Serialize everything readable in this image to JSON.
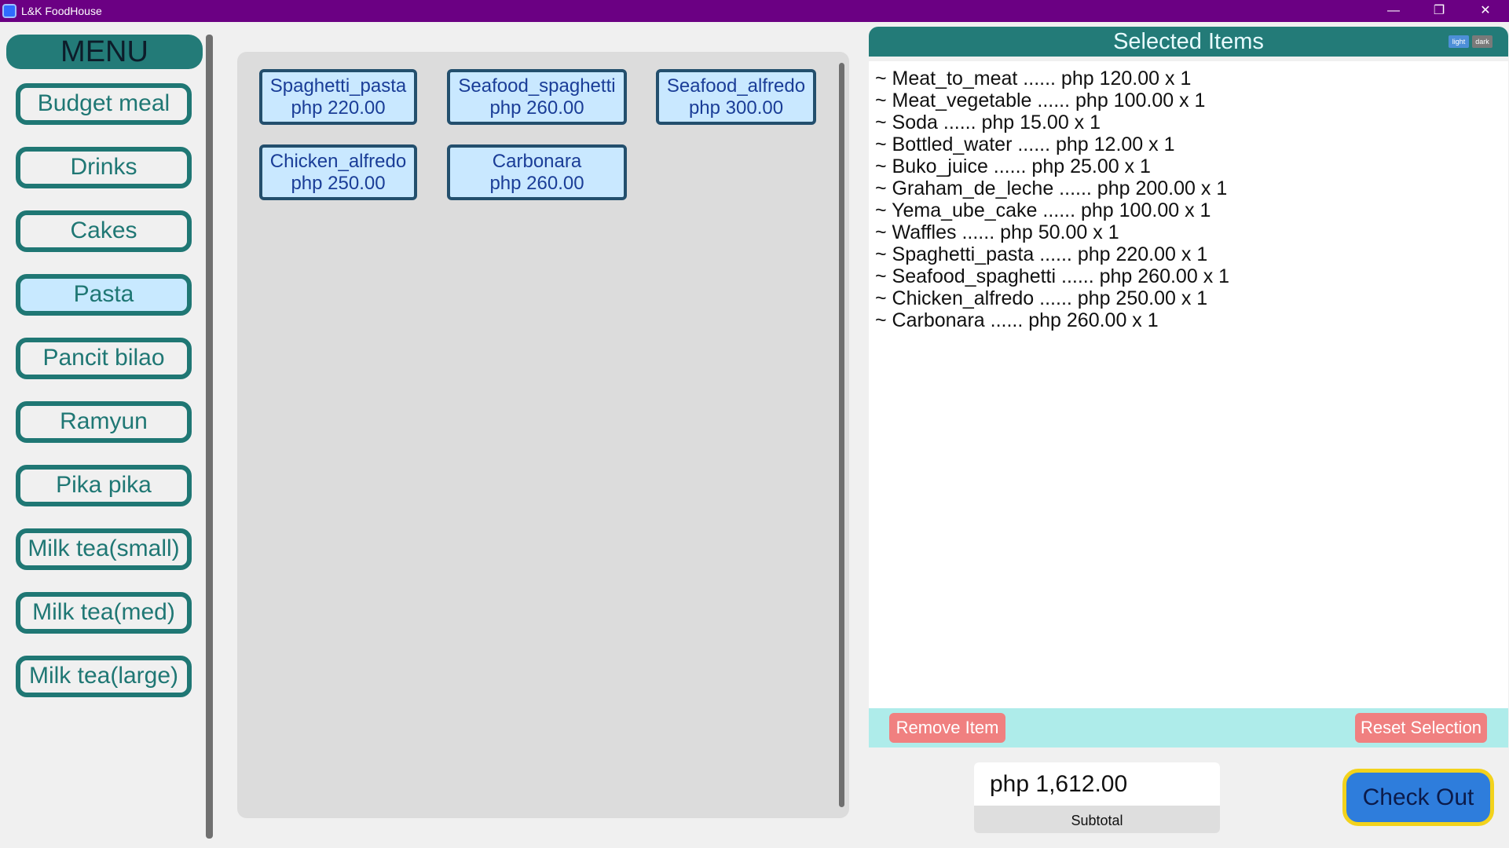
{
  "window": {
    "title": "L&K FoodHouse",
    "minimize_glyph": "—",
    "maximize_glyph": "❐",
    "close_glyph": "✕"
  },
  "menu": {
    "header": "MENU",
    "items": [
      {
        "label": "Budget meal",
        "active": false
      },
      {
        "label": "Drinks",
        "active": false
      },
      {
        "label": "Cakes",
        "active": false
      },
      {
        "label": "Pasta",
        "active": true
      },
      {
        "label": "Pancit bilao",
        "active": false
      },
      {
        "label": "Ramyun",
        "active": false
      },
      {
        "label": "Pika pika",
        "active": false
      },
      {
        "label": "Milk tea(small)",
        "active": false
      },
      {
        "label": "Milk tea(med)",
        "active": false
      },
      {
        "label": "Milk tea(large)",
        "active": false
      }
    ]
  },
  "products": [
    {
      "name": "Spaghetti_pasta",
      "price": "php 220.00"
    },
    {
      "name": "Seafood_spaghetti",
      "price": "php 260.00"
    },
    {
      "name": "Seafood_alfredo",
      "price": "php 300.00"
    },
    {
      "name": "Chicken_alfredo",
      "price": "php 250.00"
    },
    {
      "name": "Carbonara",
      "price": "php 260.00"
    }
  ],
  "selected": {
    "title": "Selected Items",
    "theme_light": "light",
    "theme_dark": "dark",
    "items": [
      "~ Meat_to_meat ...... php 120.00 x 1",
      "~ Meat_vegetable ...... php 100.00 x 1",
      "~ Soda ...... php 15.00 x 1",
      "~ Bottled_water ...... php 12.00 x 1",
      "~ Buko_juice ...... php 25.00 x 1",
      "~ Graham_de_leche ...... php 200.00 x 1",
      "~ Yema_ube_cake ...... php 100.00 x 1",
      "~ Waffles ...... php 50.00 x 1",
      "~ Spaghetti_pasta ...... php 220.00 x 1",
      "~ Seafood_spaghetti ...... php 260.00 x 1",
      "~ Chicken_alfredo ...... php 250.00 x 1",
      "~ Carbonara ...... php 260.00 x 1"
    ],
    "remove_label": "Remove Item",
    "reset_label": "Reset Selection"
  },
  "subtotal": {
    "value": "php 1,612.00",
    "label": "Subtotal"
  },
  "checkout_label": "Check Out",
  "colors": {
    "titlebar": "#6b0083",
    "teal": "#1f7774",
    "active_bg": "#c8e9ff",
    "red_button": "#f08080",
    "checkout_bg": "#2e7ddc",
    "checkout_border": "#f2d21c"
  }
}
